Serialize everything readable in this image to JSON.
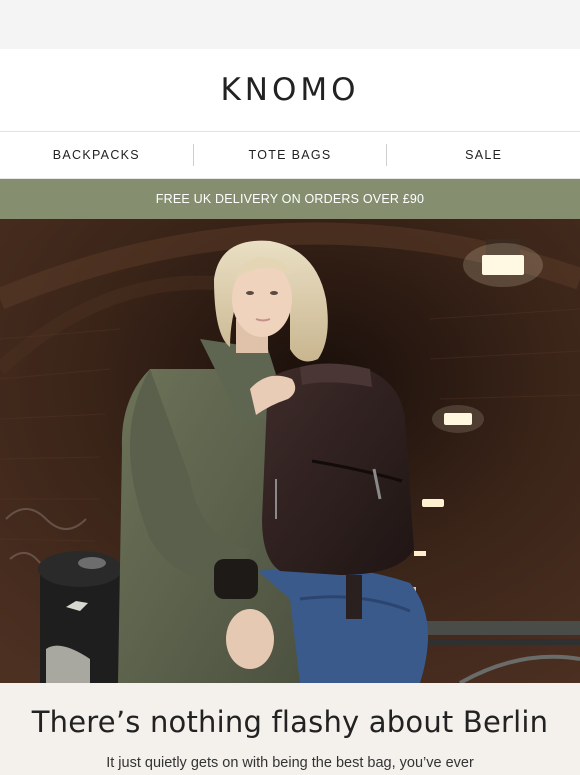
{
  "header": {
    "logo_text": "KNOMO"
  },
  "nav": {
    "items": [
      {
        "label": "BACKPACKS"
      },
      {
        "label": "TOTE BAGS"
      },
      {
        "label": "SALE"
      }
    ]
  },
  "promo": {
    "text": "FREE UK DELIVERY ON ORDERS OVER £90"
  },
  "hero": {
    "alt": "Woman in olive parka holding a dark brown backpack under a brick archway"
  },
  "content": {
    "headline": "There’s nothing flashy about Berlin",
    "body": "It just quietly gets on with being the best bag, you’ve ever"
  },
  "colors": {
    "promo_bg": "#858f70",
    "content_bg": "#f4f1ed"
  }
}
